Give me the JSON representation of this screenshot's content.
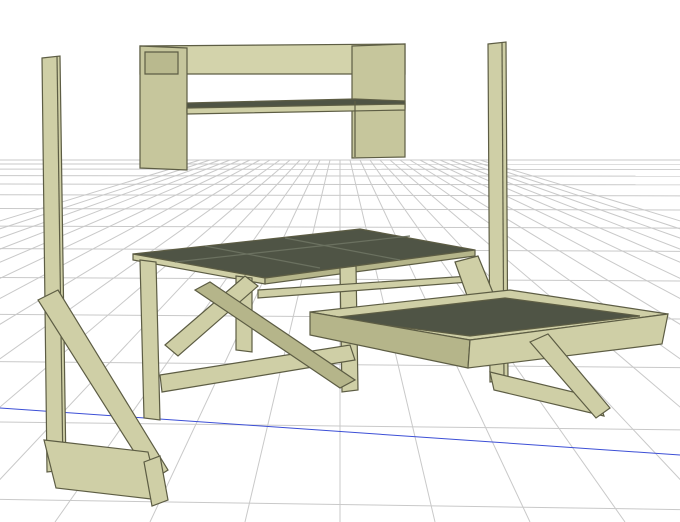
{
  "scene": {
    "colors": {
      "background": "#ffffff",
      "grid": "#c9c9c9",
      "axis": "#3c4fd6",
      "wood": "#cfcfa6",
      "wood_side": "#b5b58a",
      "wood_edge": "#5d5d44",
      "panel": "#4f5445",
      "panel_light": "#6b7160"
    },
    "parts": [
      "left-post",
      "right-post",
      "left-brace-assembly",
      "wall-shelf-unit",
      "workbench",
      "pull-out-tray",
      "right-brace-assembly"
    ]
  }
}
